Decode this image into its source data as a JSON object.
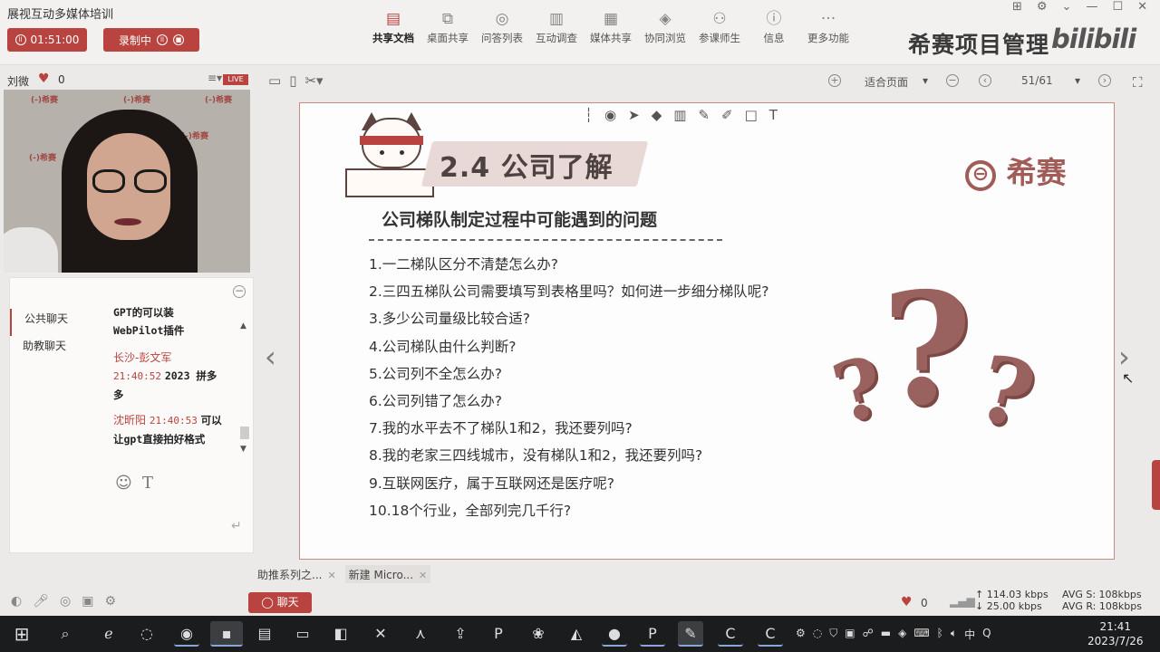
{
  "app": {
    "title": "展视互动多媒体培训",
    "timer": "01:51:00",
    "recording_label": "录制中",
    "brand": "希赛项目管理",
    "bili_logo": "bilibili"
  },
  "toolbar": [
    {
      "label": "共享文档",
      "icon": "document-icon",
      "glyph": "▤"
    },
    {
      "label": "桌面共享",
      "icon": "screen-share-icon",
      "glyph": "⧉"
    },
    {
      "label": "问答列表",
      "icon": "qa-icon",
      "glyph": "◎"
    },
    {
      "label": "互动调查",
      "icon": "poll-icon",
      "glyph": "▥"
    },
    {
      "label": "媒体共享",
      "icon": "film-icon",
      "glyph": "▦"
    },
    {
      "label": "协同浏览",
      "icon": "compass-icon",
      "glyph": "◈"
    },
    {
      "label": "参课师生",
      "icon": "users-icon",
      "glyph": "⚇"
    },
    {
      "label": "信息",
      "icon": "info-icon",
      "glyph": "ⓘ"
    },
    {
      "label": "更多功能",
      "icon": "more-icon",
      "glyph": "···"
    }
  ],
  "left": {
    "user_name": "刘微",
    "likes": "0",
    "live_badge": "LIVE",
    "chat_tabs": [
      "公共聊天",
      "助教聊天"
    ],
    "messages": [
      {
        "text": "GPT的可以装WebPilot插件"
      },
      {
        "name": "长沙-彭文军",
        "time": "21:40:52",
        "text": "2023 拼多多"
      },
      {
        "name": "沈昕阳",
        "time": "21:40:53",
        "text": "可以让gpt直接拍好格式"
      }
    ]
  },
  "viewer": {
    "fit_label": "适合页面",
    "page": "51/61"
  },
  "slide": {
    "section_title": "2.4 公司了解",
    "logo_text": "希赛",
    "subtitle": "公司梯队制定过程中可能遇到的问题",
    "questions": [
      "1.一二梯队区分不清楚怎么办?",
      "2.三四五梯队公司需要填写到表格里吗？如何进一步细分梯队呢?",
      "3.多少公司量级比较合适?",
      "4.公司梯队由什么判断?",
      "5.公司列不全怎么办?",
      "6.公司列错了怎么办?",
      "7.我的水平去不了梯队1和2，我还要列吗?",
      "8.我的老家三四线城市，没有梯队1和2，我还要列吗?",
      "9.互联网医疗，属于互联网还是医疗呢?",
      "10.18个行业，全部列完几千行?"
    ]
  },
  "bottom": {
    "file_tabs": [
      "助推系列之...",
      "新建 Micro..."
    ],
    "chat_button": "聊天",
    "likes": "0",
    "up_speed": "114.03 kbps",
    "down_speed": "25.00 kbps",
    "avg_s": "AVG S: 108kbps",
    "avg_r": "AVG R: 108kbps"
  },
  "taskbar": {
    "time": "21:41",
    "date": "2023/7/26",
    "ime": "中"
  },
  "colors": {
    "accent": "#b9433e",
    "slide_brown": "#9a625f"
  }
}
